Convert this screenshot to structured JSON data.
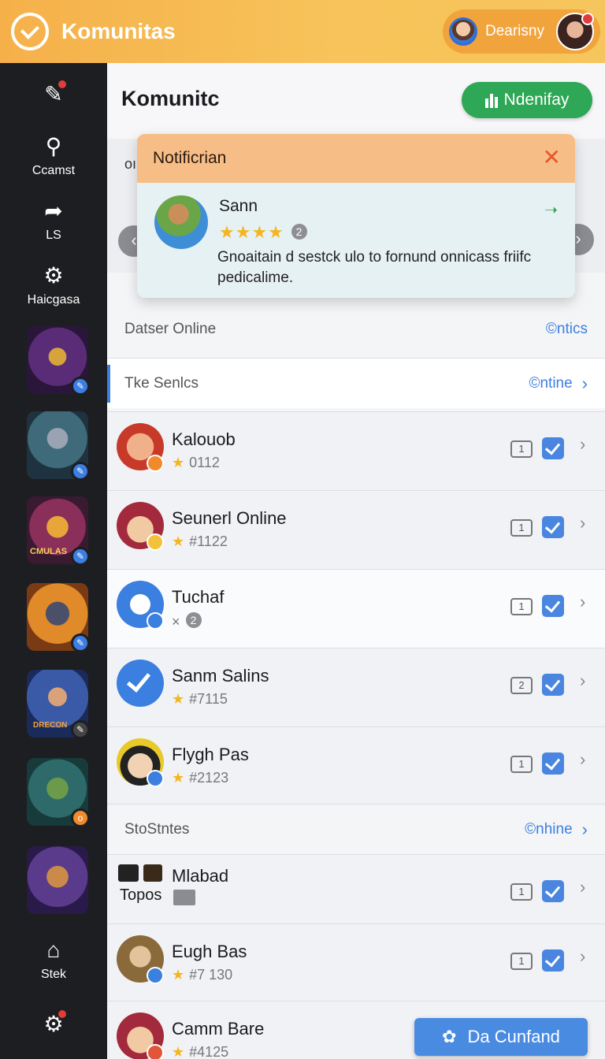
{
  "app": {
    "title": "Komunitas"
  },
  "user": {
    "name": "Dearisny"
  },
  "sidebar": {
    "nav": [
      {
        "icon": "message-badge-icon",
        "label": ""
      },
      {
        "icon": "pin-icon",
        "label": "Ccamst"
      },
      {
        "icon": "share-arrow-icon",
        "label": "LS"
      },
      {
        "icon": "gear-icon",
        "label": "Haicgasa"
      }
    ],
    "bottom_nav": [
      {
        "icon": "home-icon",
        "label": "Stek"
      },
      {
        "icon": "gear-badge-icon",
        "label": ""
      }
    ],
    "tile_texts": [
      "CMULAS",
      "DRECON"
    ]
  },
  "main": {
    "title": "Komunitc",
    "notify_button": "Ndenifay",
    "under_text": "oı"
  },
  "notification": {
    "title": "Notificrian",
    "name": "Sann",
    "stars": "★★★★",
    "rating_count": "2",
    "message": "Gnoaitain d sestck ulo to fornund onnicass friifc pedicalime."
  },
  "sections": [
    {
      "label": "Datser Online",
      "link": "©ntics"
    },
    {
      "label": "Tke Senlcs",
      "link": "©ntine"
    },
    {
      "label": "StoStntes",
      "link": "©nhine"
    }
  ],
  "rows": [
    {
      "name": "Kalouob",
      "meta": "0112",
      "count": "1",
      "colors": [
        "#c73a2a",
        "#f0b08a"
      ],
      "badge": "#f08a2a"
    },
    {
      "name": "Seunerl Online",
      "meta": "#1122",
      "count": "1",
      "colors": [
        "#a32a3c",
        "#f1c9a2"
      ],
      "badge": "#f3c23a"
    },
    {
      "name": "Tuchaf",
      "meta": "×",
      "meta_count": "2",
      "count": "1",
      "colors": [
        "#3b7fe0",
        "#ffffff"
      ],
      "badge": "#3b7fe0"
    },
    {
      "name": "Sanm Salins",
      "meta": "#7115",
      "count": "2",
      "colors": [
        "#3b7fe0",
        "#ffffff"
      ],
      "badge": "#3b7fe0"
    },
    {
      "name": "Flygh Pas",
      "meta": "#2123",
      "count": "1",
      "colors": [
        "#e9c82a",
        "#222222"
      ],
      "badge": "#3b7fe0"
    },
    {
      "name": "Mlabad",
      "sub": "Topos",
      "count": "1"
    },
    {
      "name": "Eugh Bas",
      "meta": "#7 130",
      "count": "1",
      "colors": [
        "#8a6a3a",
        "#e2c39c"
      ],
      "badge": "#3b7fe0"
    },
    {
      "name": "Camm Bare",
      "meta": "#4125",
      "colors": [
        "#a32a3c",
        "#f1c9a2"
      ],
      "badge": "#e2553a"
    }
  ],
  "fab": {
    "label": "Da Cunfand"
  }
}
